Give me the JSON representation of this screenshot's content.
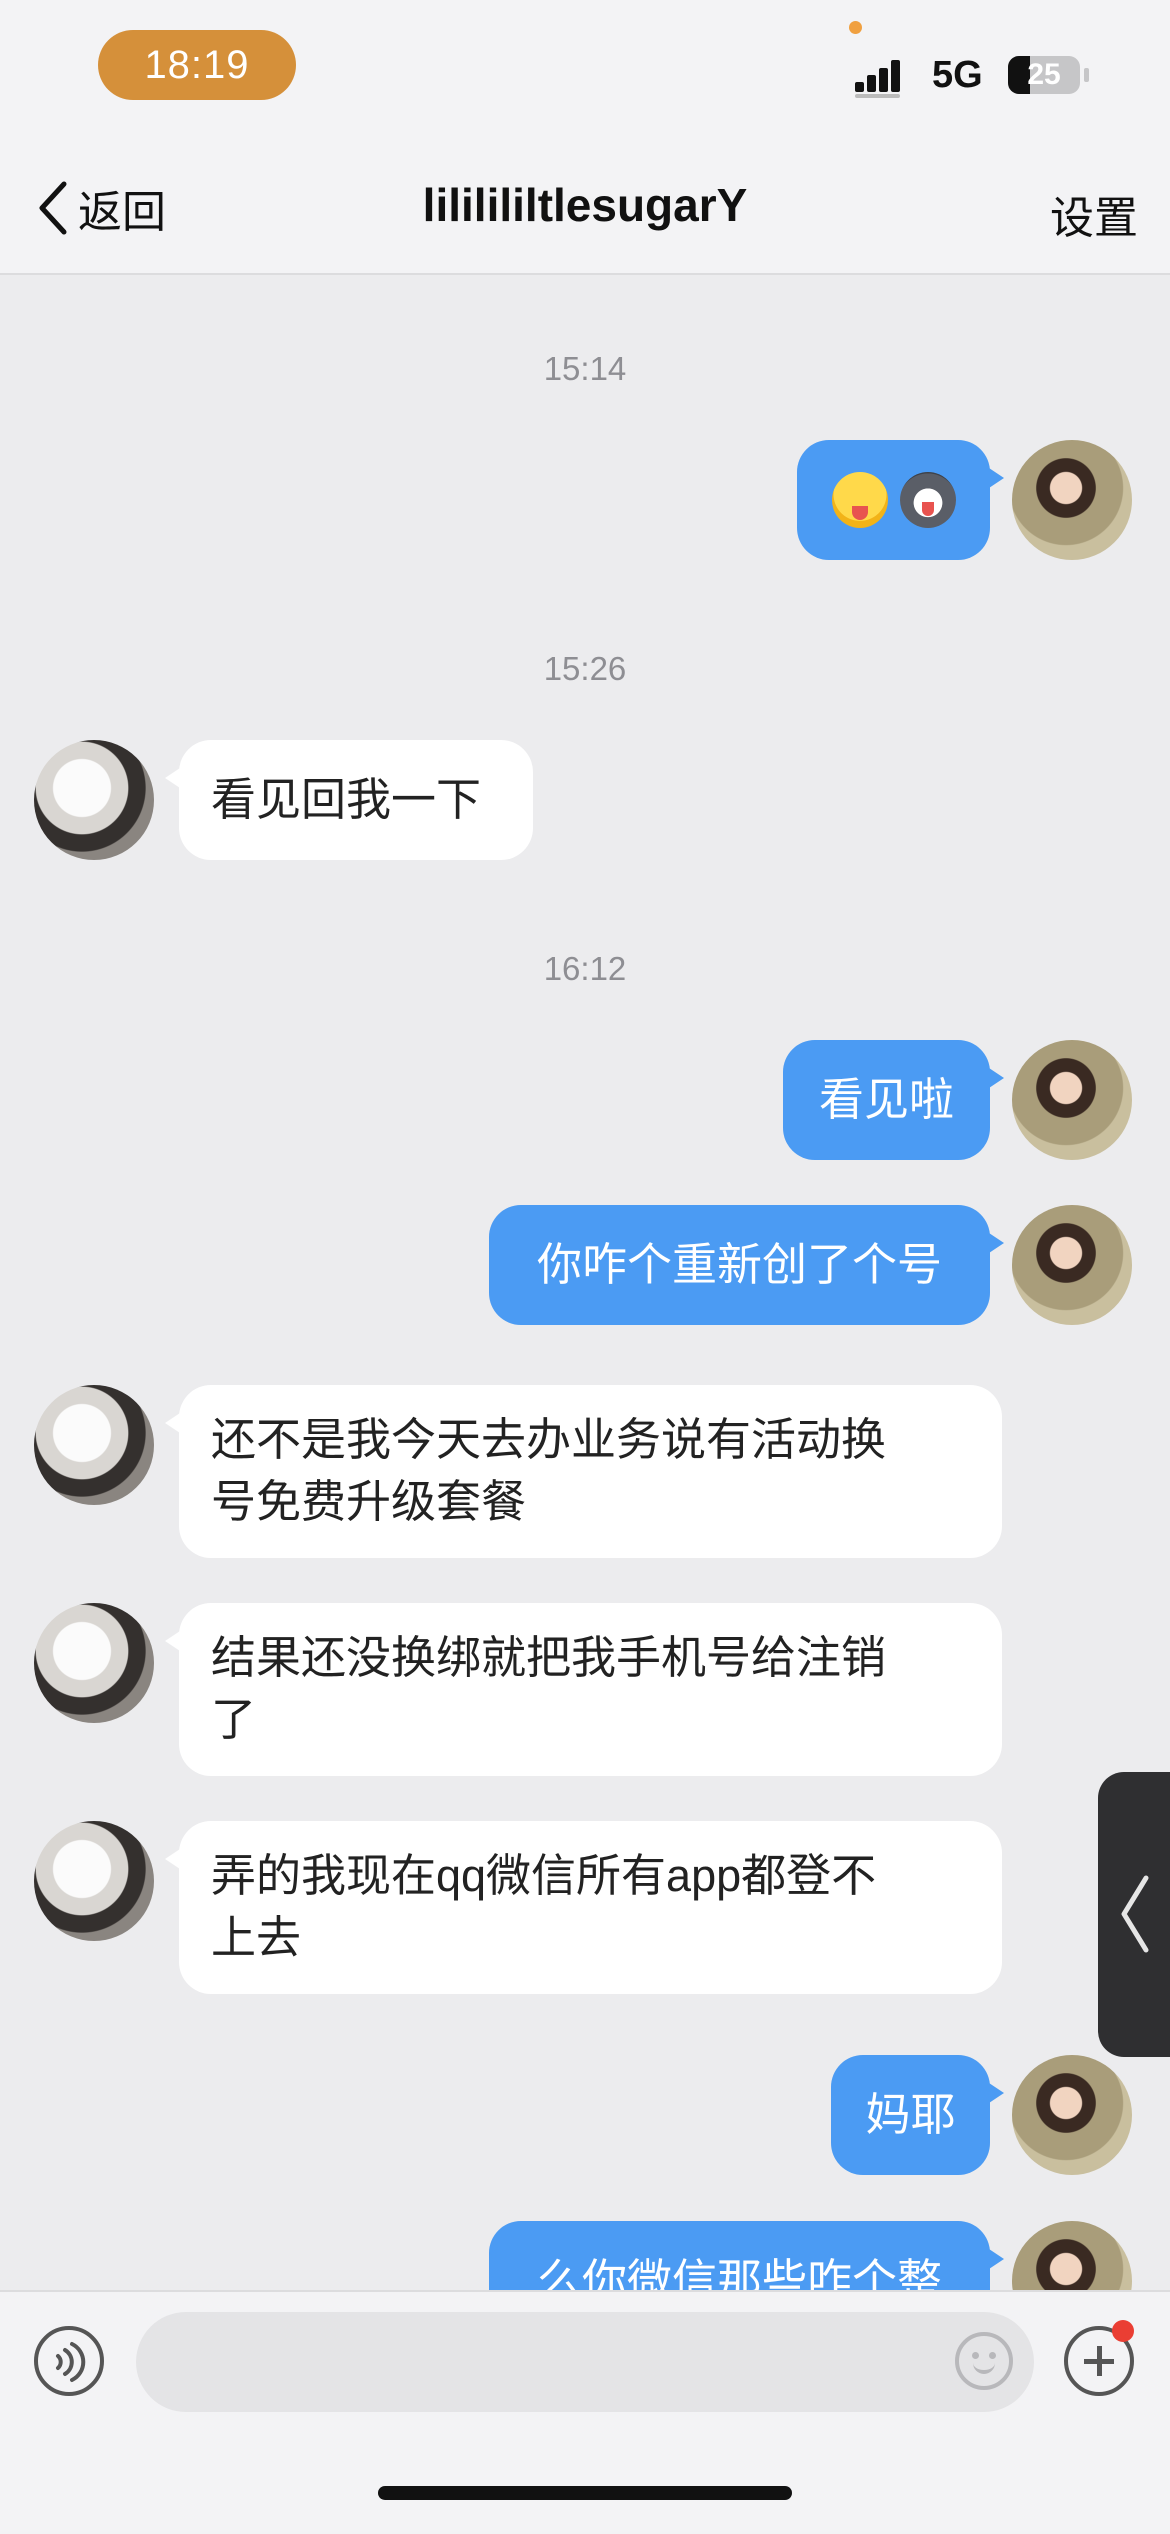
{
  "status_bar": {
    "time": "18:19",
    "network": "5G",
    "battery": "25"
  },
  "nav": {
    "back_label": "返回",
    "title": "lililililtlesugarY",
    "settings_label": "设置"
  },
  "messages": [
    {
      "type": "timestamp",
      "text": "15:14"
    },
    {
      "type": "outgoing",
      "content": "emoji",
      "emojis": [
        "tongue-face-emoji",
        "husky-dog-emoji"
      ]
    },
    {
      "type": "timestamp",
      "text": "15:26"
    },
    {
      "type": "incoming",
      "text": "看见回我一下"
    },
    {
      "type": "timestamp",
      "text": "16:12"
    },
    {
      "type": "outgoing",
      "text": "看见啦"
    },
    {
      "type": "outgoing",
      "text": "你咋个重新创了个号"
    },
    {
      "type": "incoming",
      "lines": [
        "还不是我今天去办业务说有活动换",
        "号免费升级套餐"
      ]
    },
    {
      "type": "incoming",
      "lines": [
        "结果还没换绑就把我手机号给注销",
        "了"
      ]
    },
    {
      "type": "incoming",
      "lines": [
        "弄的我现在qq微信所有app都登不",
        "上去"
      ]
    },
    {
      "type": "outgoing",
      "text": "妈耶"
    },
    {
      "type": "outgoing",
      "text": "么你微信那些咋个整",
      "clipped": true
    }
  ],
  "input": {
    "value": "",
    "placeholder": ""
  },
  "colors": {
    "outgoing_bubble": "#4b9bf3",
    "incoming_bubble": "#ffffff",
    "background": "#ececee",
    "time_pill": "#d5903a"
  }
}
